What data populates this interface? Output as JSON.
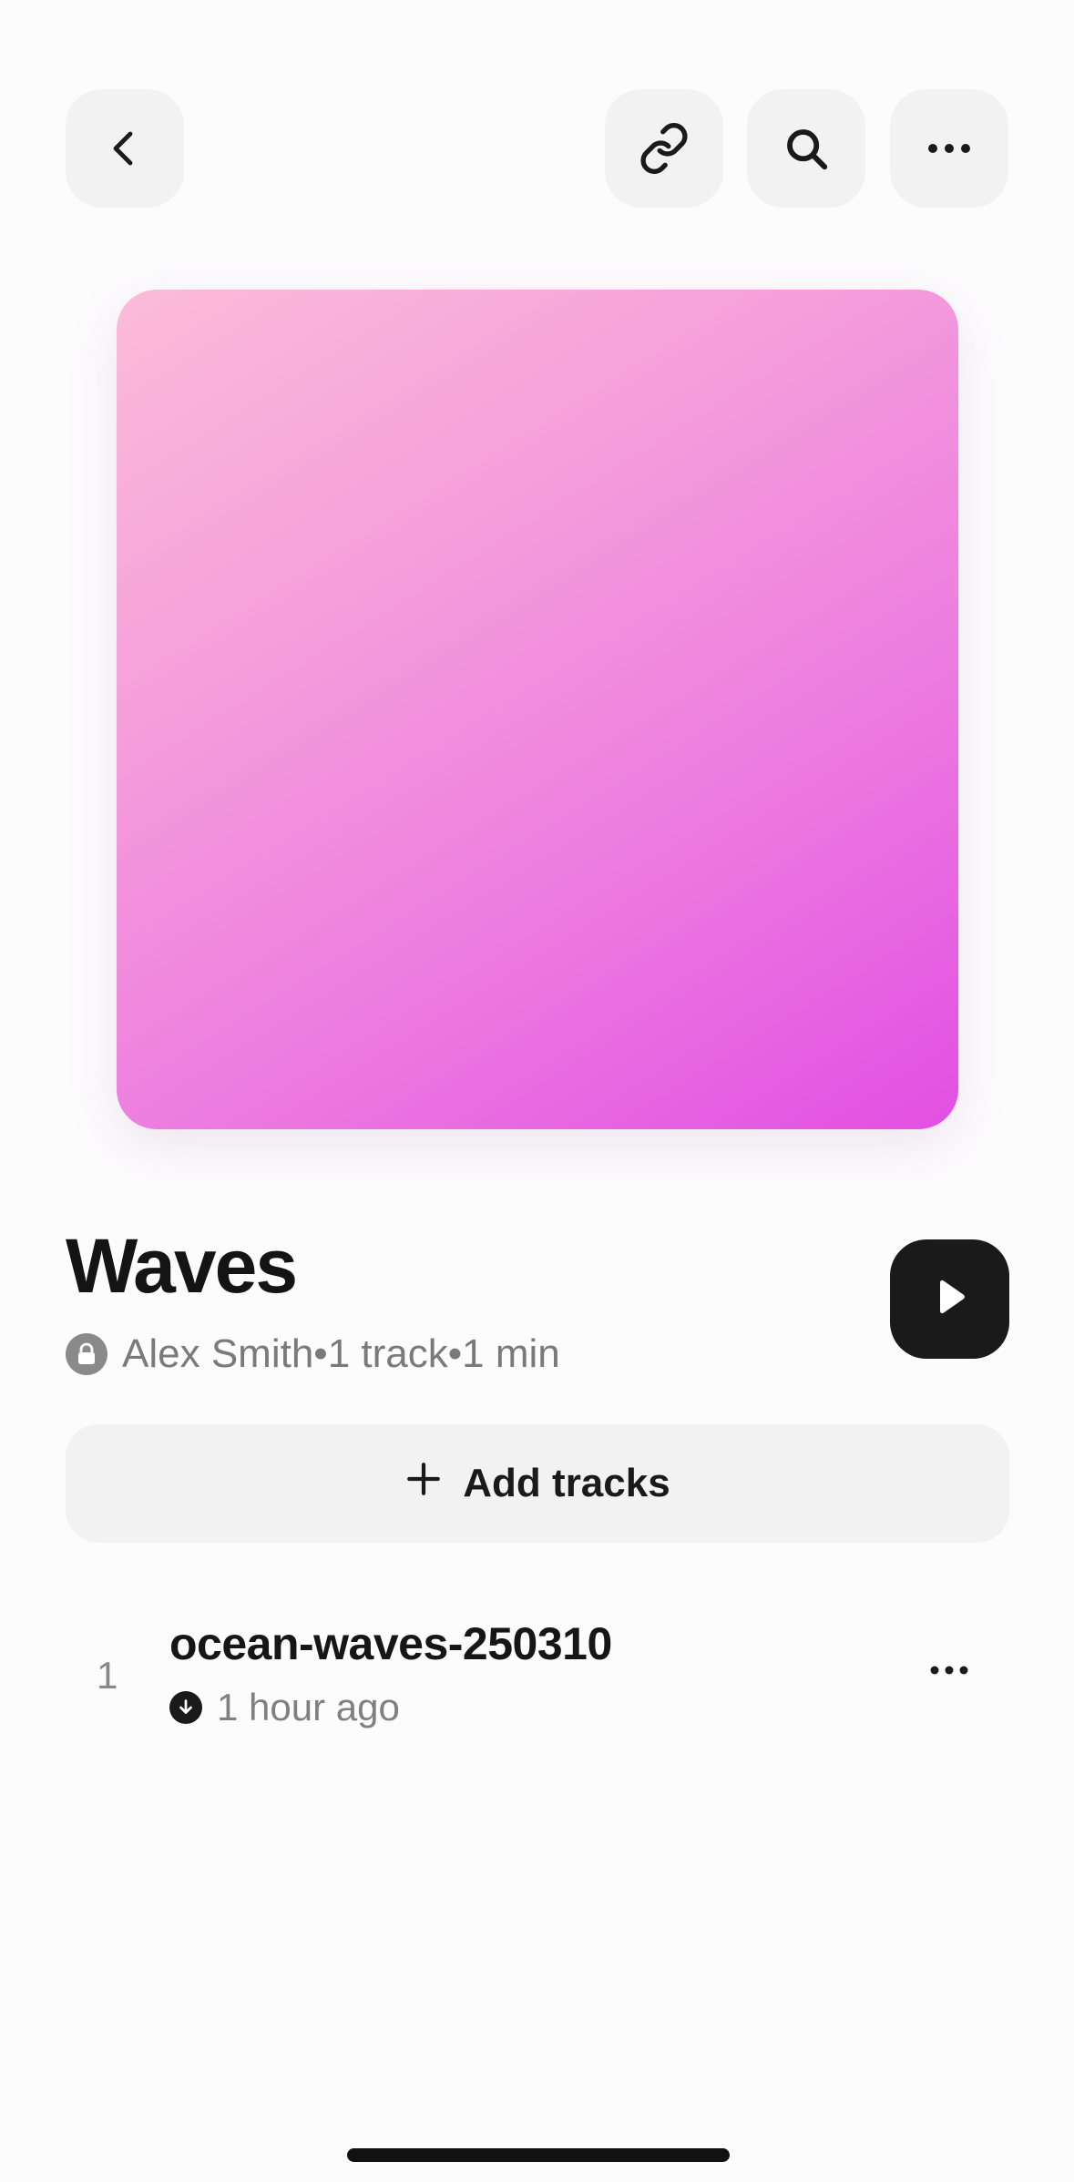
{
  "header": {
    "back_icon": "chevron-left-icon",
    "link_icon": "link-icon",
    "search_icon": "search-icon",
    "more_icon": "more-horizontal-icon"
  },
  "playlist": {
    "title": "Waves",
    "owner": "Alex Smith",
    "track_count": "1 track",
    "duration": "1 min",
    "separator": " • ",
    "cover_gradient": [
      "#fcbcda",
      "#e24fe3"
    ]
  },
  "actions": {
    "add_tracks_label": "Add tracks"
  },
  "tracks": [
    {
      "number": "1",
      "title": "ocean-waves-250310",
      "added": "1 hour ago"
    }
  ],
  "colors": {
    "button_bg": "#f2f2f2",
    "play_bg": "#1a1a1a",
    "text_primary": "#141414",
    "text_secondary": "#7a7a7a"
  }
}
